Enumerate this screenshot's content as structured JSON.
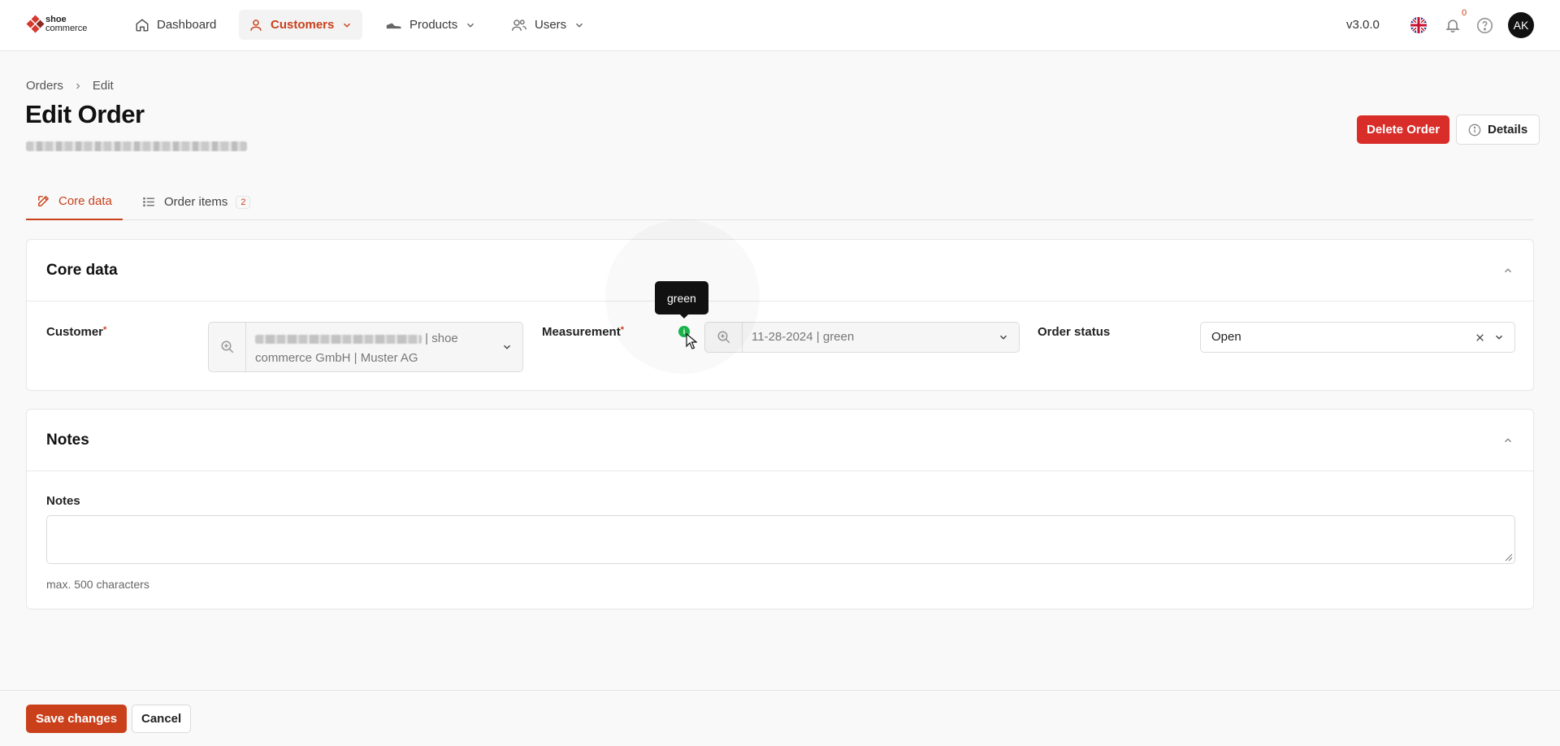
{
  "app": {
    "logo_line1": "shoe",
    "logo_line2": "commerce",
    "version": "v3.0.0",
    "brand_color": "#c9401b"
  },
  "nav": {
    "items": [
      {
        "label": "Dashboard",
        "icon": "home-icon"
      },
      {
        "label": "Customers",
        "icon": "user-icon",
        "active": true
      },
      {
        "label": "Products",
        "icon": "shoe-icon"
      },
      {
        "label": "Users",
        "icon": "users-icon"
      }
    ],
    "notifications_count": "0",
    "avatar_initials": "AK",
    "language_icon": "uk-flag-icon"
  },
  "breadcrumb": {
    "parent": "Orders",
    "current": "Edit"
  },
  "header": {
    "title": "Edit Order",
    "delete_label": "Delete Order",
    "details_label": "Details"
  },
  "tabs": [
    {
      "label": "Core data",
      "icon": "edit-icon"
    },
    {
      "label": "Order items",
      "icon": "list-icon",
      "count": "2"
    }
  ],
  "core": {
    "title": "Core data",
    "customer_label": "Customer",
    "customer_value_line1": "| shoe",
    "customer_value_line2": "commerce GmbH | Muster AG",
    "measurement_label": "Measurement",
    "measurement_value": "11-28-2024 | green",
    "tooltip": "green",
    "status_label": "Order status",
    "status_value": "Open"
  },
  "notes": {
    "title": "Notes",
    "label": "Notes",
    "value": "",
    "hint": "max. 500 characters"
  },
  "footer": {
    "save_label": "Save changes",
    "cancel_label": "Cancel"
  }
}
